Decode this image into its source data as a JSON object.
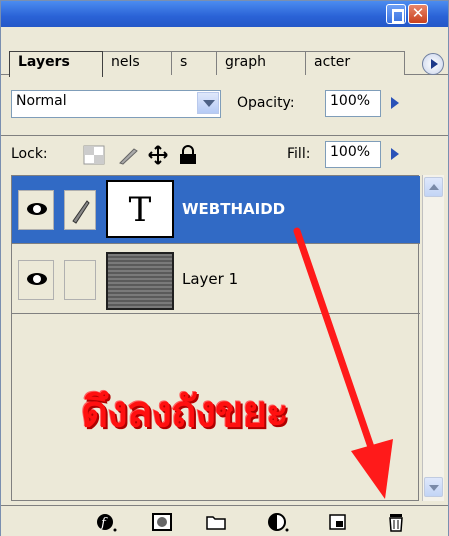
{
  "panel": {
    "tabs": [
      {
        "label": "Layers",
        "active": true
      },
      {
        "label": "nels",
        "active": false
      },
      {
        "label": "s",
        "active": false
      },
      {
        "label": "graph",
        "active": false
      },
      {
        "label": "acter",
        "active": false
      }
    ]
  },
  "options": {
    "blend_mode": "Normal",
    "opacity_label": "Opacity:",
    "opacity_value": "100%",
    "lock_label": "Lock:",
    "fill_label": "Fill:",
    "fill_value": "100%"
  },
  "layers": [
    {
      "name": "WEBTHAIDD",
      "thumb": "T",
      "selected": true
    },
    {
      "name": "Layer 1",
      "thumb": "",
      "selected": false
    }
  ],
  "annotation": {
    "text": "ดึงลงถังขยะ",
    "color": "#ff1010"
  },
  "toolbar_icons": [
    "layer-style-icon",
    "layer-mask-icon",
    "new-group-icon",
    "adjustment-layer-icon",
    "new-layer-icon",
    "trash-icon"
  ],
  "colors": {
    "selection": "#316ac5",
    "titlebar": "#2a62d6",
    "panel_bg": "#ece9d8"
  }
}
